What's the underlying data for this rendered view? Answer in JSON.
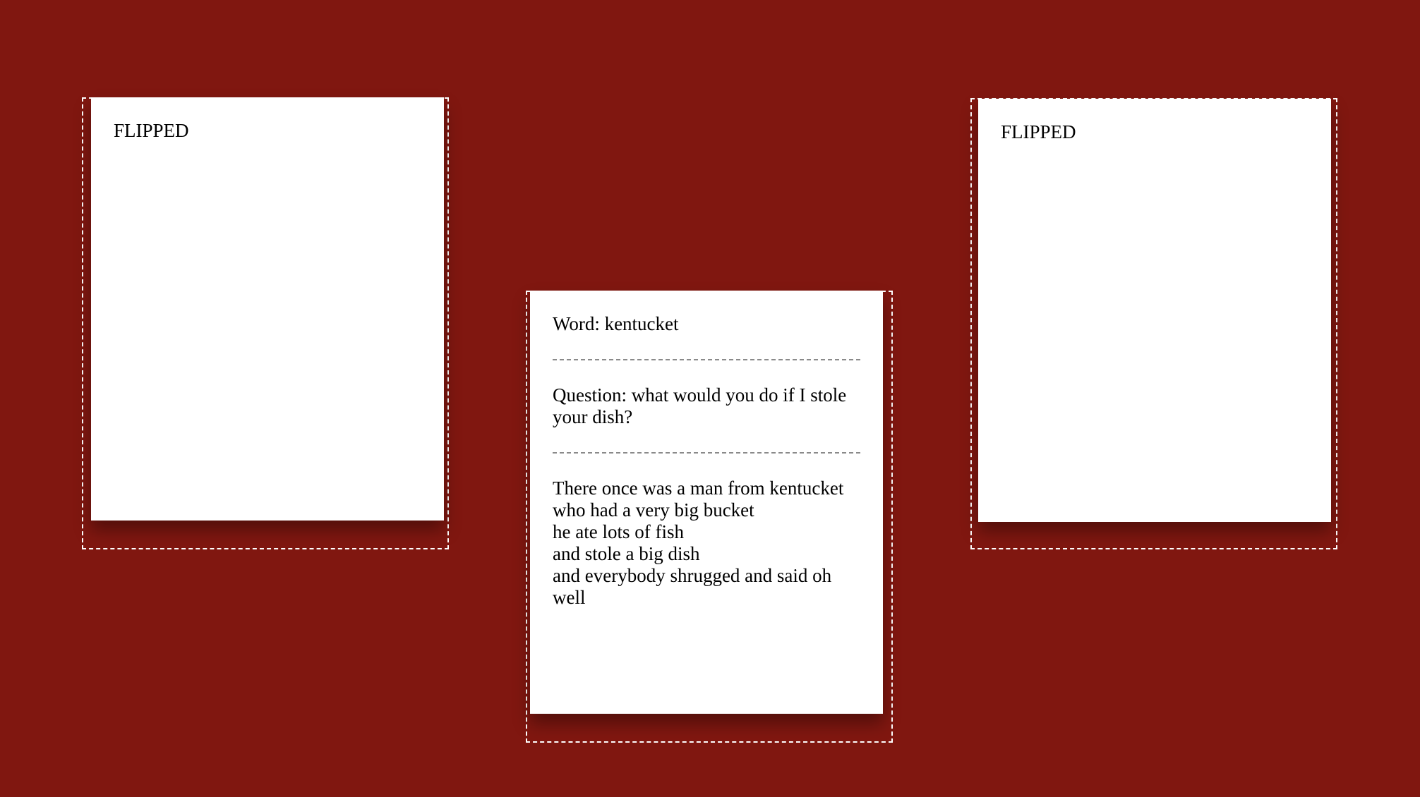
{
  "cards": {
    "left": {
      "status_label": "FLIPPED"
    },
    "center": {
      "word_line": "Word: kentucket",
      "question_line": "Question: what would you do if I stole your dish?",
      "poem_lines": [
        "There once was a man from kentucket",
        "who had a very big bucket",
        "he ate lots of fish",
        "and stole a big dish",
        "and everybody shrugged and said oh well"
      ]
    },
    "right": {
      "status_label": "FLIPPED"
    }
  },
  "colors": {
    "background": "#801710",
    "card": "#ffffff",
    "slot_border": "#ffffff",
    "divider": "#8a8a8a"
  }
}
